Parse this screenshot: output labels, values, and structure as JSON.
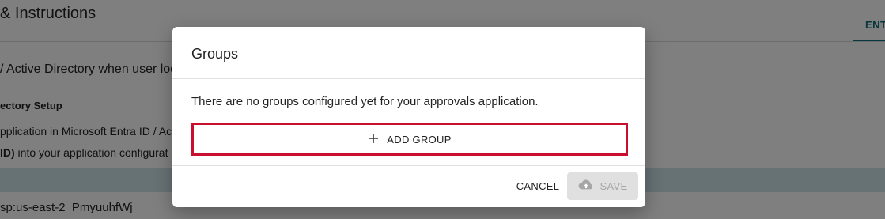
{
  "background": {
    "title": "& Instructions",
    "tab_label": "ENTI",
    "line1": "/ Active Directory when user log",
    "setup_heading": "ectory Setup",
    "line2": "pplication in Microsoft Entra ID / Ac",
    "line3_bold": "ID)",
    "line3_rest": " into your application configurat",
    "line4": "sp:us-east-2_PmyuuhfWj"
  },
  "dialog": {
    "title": "Groups",
    "message": "There are no groups configured yet for your approvals application.",
    "add_icon": "plus-icon",
    "add_label": "ADD GROUP",
    "cancel_label": "CANCEL",
    "save_icon": "cloud-upload-icon",
    "save_label": "SAVE"
  },
  "colors": {
    "highlight_border": "#c8102e",
    "accent": "#0f6e7a",
    "disabled_bg": "#e0e0e0",
    "disabled_text": "#a6a6a6"
  }
}
